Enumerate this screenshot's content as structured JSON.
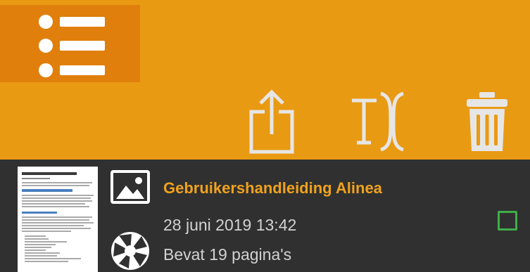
{
  "colors": {
    "toolbar_bg": "#e99a13",
    "menu_bg": "#e07f0b",
    "list_bg": "#303030",
    "title_color": "#f0a21e",
    "text_color": "#d2d2d2",
    "checkbox_color": "#3fae49",
    "action_icon_color": "#e6e6e6"
  },
  "toolbar": {
    "menu_icon": "list-menu-icon",
    "actions": [
      {
        "icon": "share-icon"
      },
      {
        "icon": "text-recognition-icon"
      },
      {
        "icon": "trash-icon"
      }
    ]
  },
  "documents": [
    {
      "type_icon": "image-icon",
      "source_icon": "camera-aperture-icon",
      "title": "Gebruikershandleiding Alinea",
      "date": "28 juni 2019 13:42",
      "pages": "Bevat 19 pagina's",
      "selected": false
    }
  ]
}
